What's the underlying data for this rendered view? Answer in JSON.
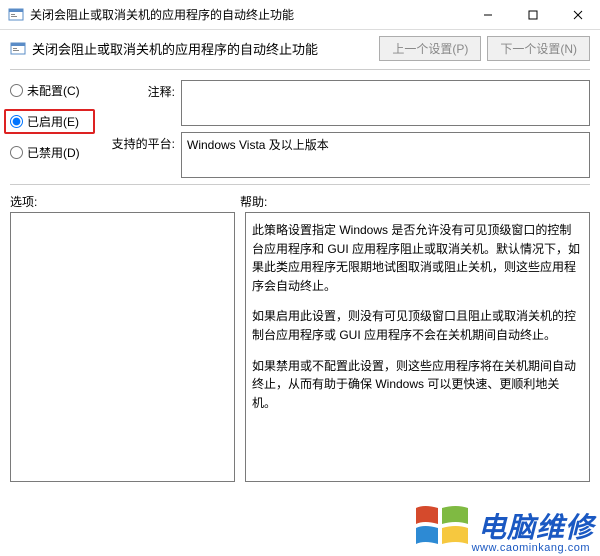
{
  "window": {
    "title": "关闭会阻止或取消关机的应用程序的自动终止功能"
  },
  "subheader": {
    "title": "关闭会阻止或取消关机的应用程序的自动终止功能",
    "prev": "上一个设置(P)",
    "next": "下一个设置(N)"
  },
  "radios": {
    "not_configured": "未配置(C)",
    "enabled": "已启用(E)",
    "disabled": "已禁用(D)"
  },
  "fields": {
    "comment_label": "注释:",
    "comment_value": "",
    "platform_label": "支持的平台:",
    "platform_value": "Windows Vista 及以上版本"
  },
  "labels": {
    "options": "选项:",
    "help": "帮助:"
  },
  "help": {
    "p1": "此策略设置指定 Windows 是否允许没有可见顶级窗口的控制台应用程序和 GUI 应用程序阻止或取消关机。默认情况下，如果此类应用程序无限期地试图取消或阻止关机，则这些应用程序会自动终止。",
    "p2": "如果启用此设置，则没有可见顶级窗口且阻止或取消关机的控制台应用程序或 GUI 应用程序不会在关机期间自动终止。",
    "p3": "如果禁用或不配置此设置，则这些应用程序将在关机期间自动终止，从而有助于确保 Windows 可以更快速、更顺利地关机。"
  },
  "watermark": {
    "text": "电脑维修",
    "url": "www.caominkang.com"
  }
}
